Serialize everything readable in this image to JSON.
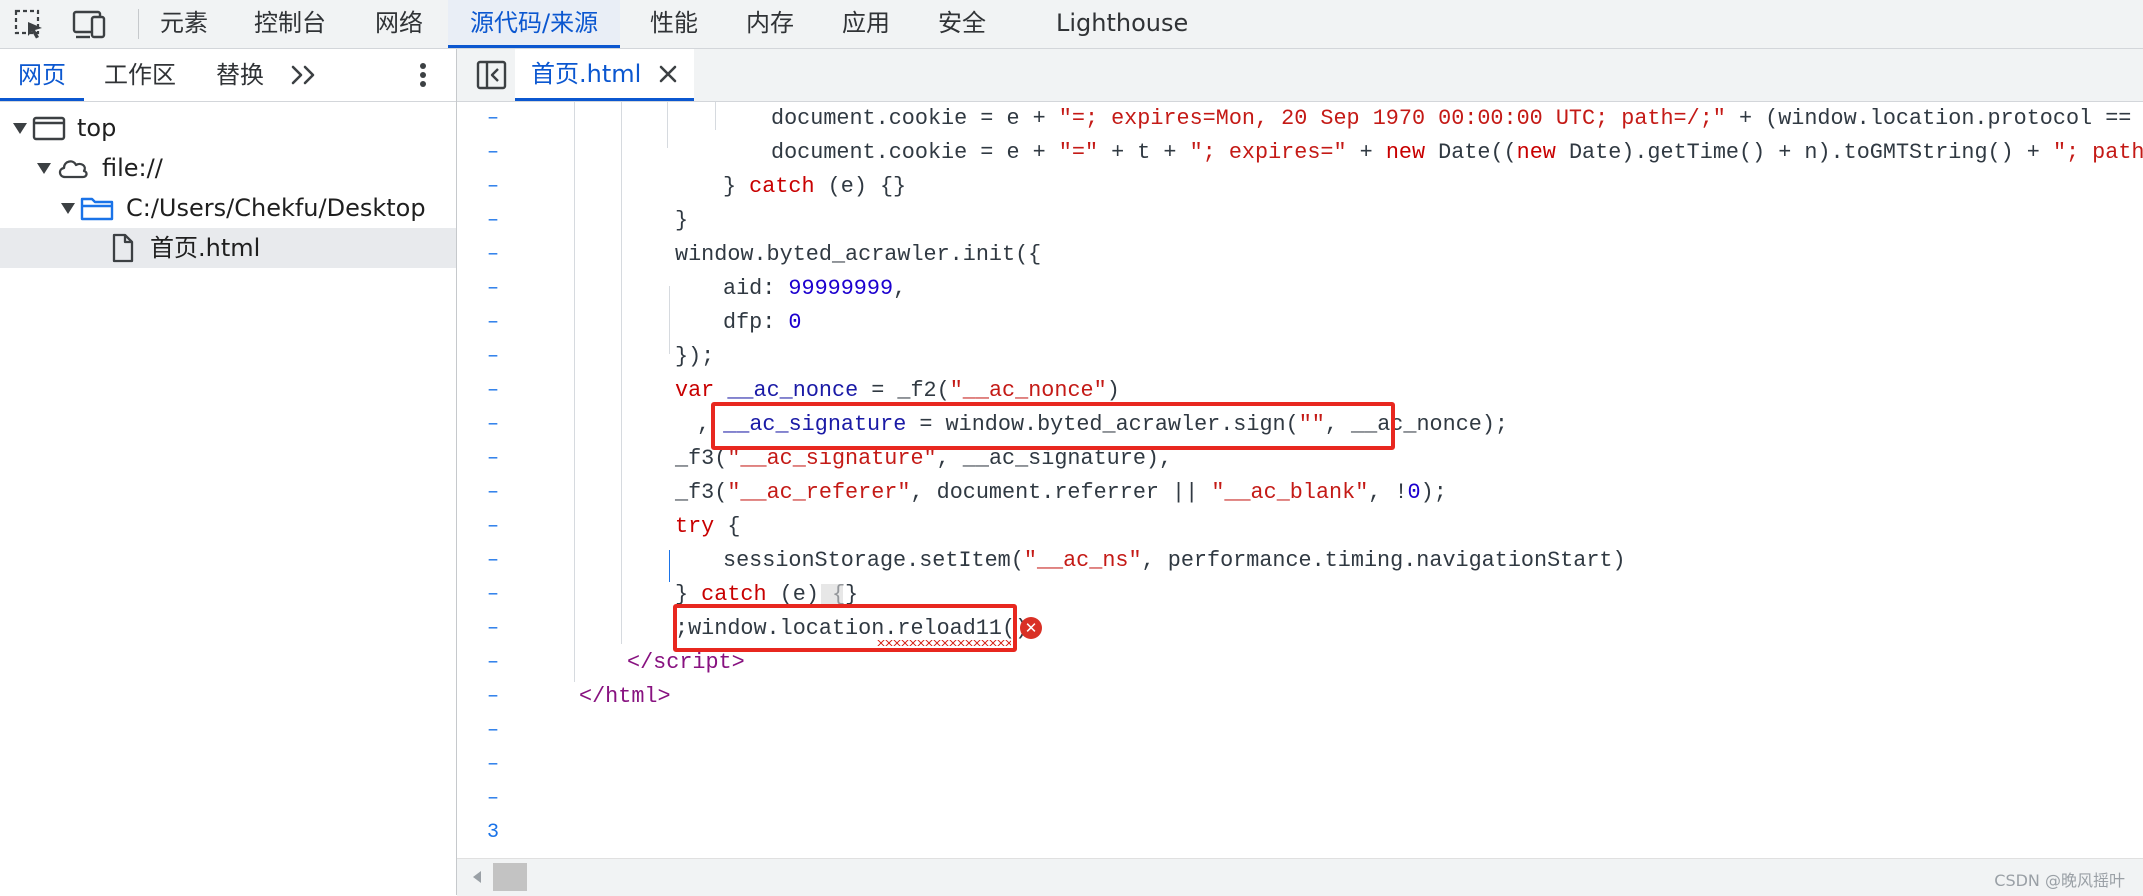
{
  "toolbar": {
    "tabs": [
      {
        "label": "元素"
      },
      {
        "label": "控制台"
      },
      {
        "label": "网络"
      },
      {
        "label": "源代码/来源"
      },
      {
        "label": "性能"
      },
      {
        "label": "内存"
      },
      {
        "label": "应用"
      },
      {
        "label": "安全"
      },
      {
        "label": "Lighthouse"
      }
    ],
    "active_tab": "源代码/来源",
    "icons": [
      "inspect-element-icon",
      "device-toolbar-icon"
    ]
  },
  "sources_sidebar": {
    "tabs": [
      {
        "label": "网页"
      },
      {
        "label": "工作区"
      },
      {
        "label": "替换"
      }
    ],
    "active_tab": "网页",
    "tree": [
      {
        "label": "top",
        "icon": "frame-icon"
      },
      {
        "label": "file://",
        "icon": "cloud-icon"
      },
      {
        "label": "C:/Users/Chekfu/Desktop",
        "icon": "folder-icon"
      },
      {
        "label": "首页.html",
        "icon": "file-icon",
        "selected": true
      }
    ]
  },
  "editor": {
    "open_file": "首页.html",
    "last_line_number": "3",
    "gutter_marker": "–"
  },
  "watermark": "CSDN @晚风摇叶",
  "colors": {
    "accent": "#0b57d0",
    "highlight_box": "#e8271f",
    "error": "#d93025"
  }
}
